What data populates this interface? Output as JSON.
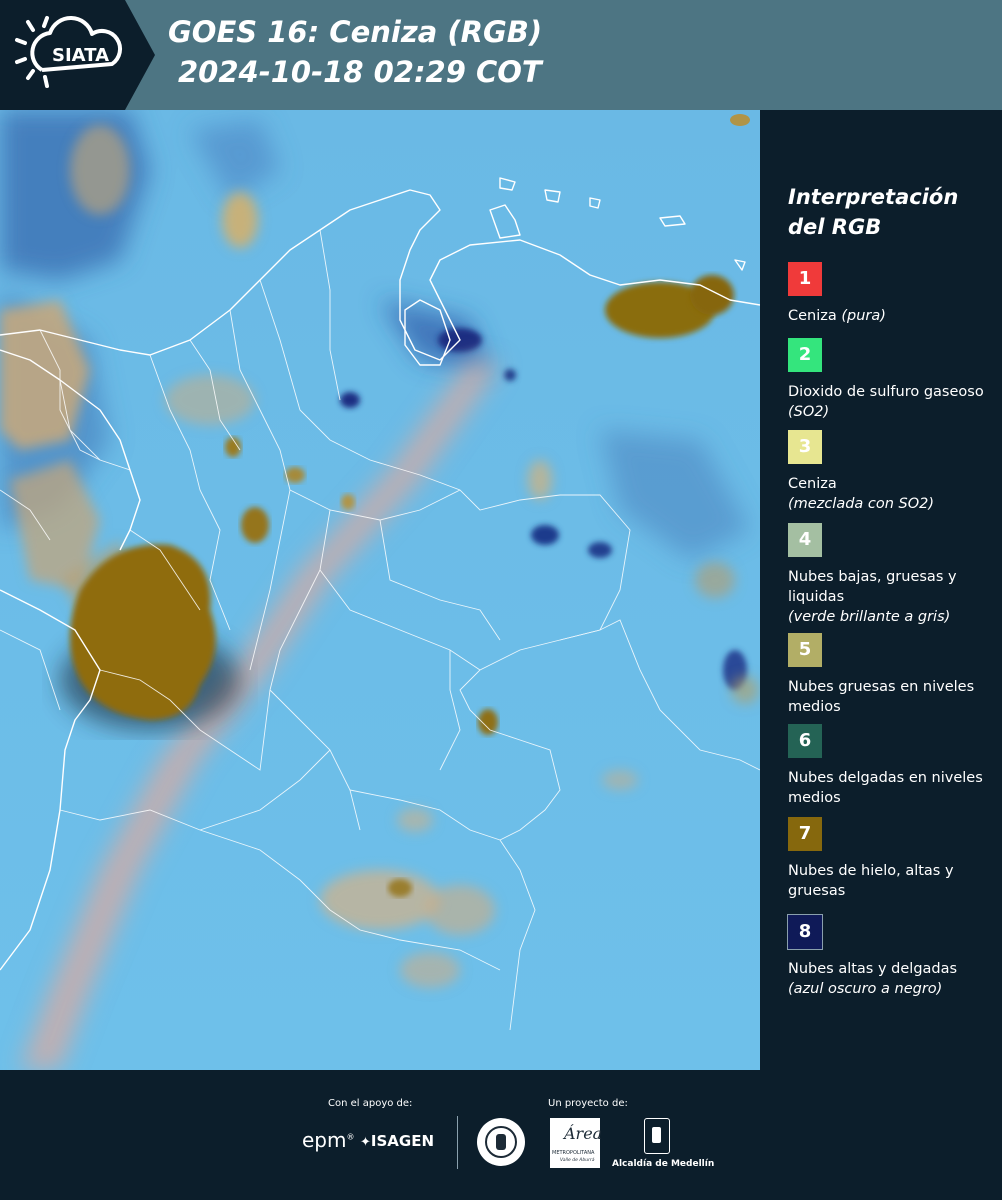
{
  "header": {
    "logo_text": "SIATA",
    "title_line1": "GOES 16: Ceniza (RGB)",
    "title_line2": "2024-10-18 02:29 COT"
  },
  "legend": {
    "title": "Interpretación del RGB",
    "items": [
      {
        "number": "1",
        "color": "#f03a3a",
        "label": "Ceniza",
        "note": "(pura)"
      },
      {
        "number": "2",
        "color": "#34e57d",
        "label": "Dioxido de sulfuro gaseoso",
        "note": "(SO2)"
      },
      {
        "number": "3",
        "color": "#e7e691",
        "label": "Ceniza",
        "note": "(mezclada con SO2)"
      },
      {
        "number": "4",
        "color": "#a4bfa2",
        "label": "Nubes bajas, gruesas y liquidas",
        "note": "(verde brillante a gris)"
      },
      {
        "number": "5",
        "color": "#b2ae66",
        "label": "Nubes gruesas en niveles medios",
        "note": ""
      },
      {
        "number": "6",
        "color": "#246355",
        "label": "Nubes delgadas en niveles medios",
        "note": ""
      },
      {
        "number": "7",
        "color": "#86680d",
        "label": "Nubes de hielo, altas y gruesas",
        "note": ""
      },
      {
        "number": "8",
        "color": "#0f1a58",
        "label": "Nubes altas y delgadas",
        "note": "(azul oscuro a negro)"
      }
    ]
  },
  "footer": {
    "support_label": "Con el apoyo de:",
    "project_label": "Un proyecto de:",
    "logo_epm": "epm",
    "logo_isagen": "ISAGEN",
    "logo_area_line1": "METROPOLITANA",
    "logo_area_line2": "Valle de Aburrá",
    "logo_medellin": "Alcaldía de Medellín"
  }
}
